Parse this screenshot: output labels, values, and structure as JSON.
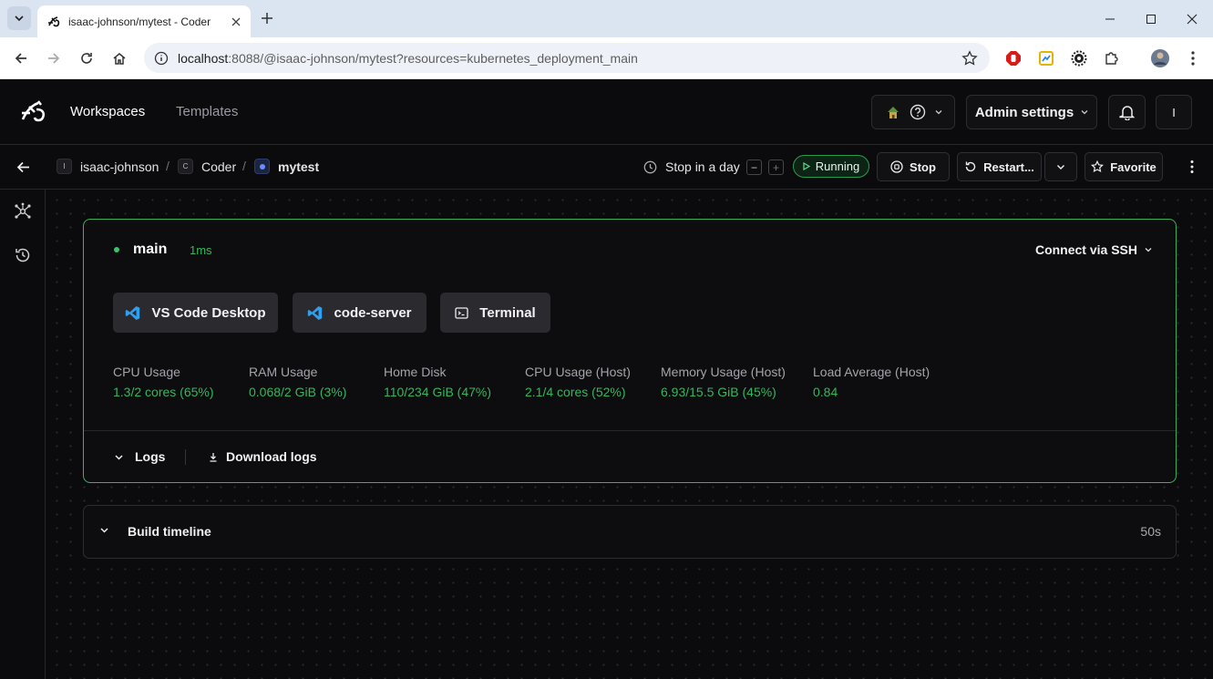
{
  "browser": {
    "tab_title": "isaac-johnson/mytest - Coder",
    "url_host": "localhost",
    "url_rest": ":8088/@isaac-johnson/mytest?resources=kubernetes_deployment_main"
  },
  "nav": {
    "workspaces": "Workspaces",
    "templates": "Templates",
    "admin_settings": "Admin settings",
    "user_initial": "I"
  },
  "workspace_bar": {
    "owner": "isaac-johnson",
    "owner_initial": "I",
    "template": "Coder",
    "template_initial": "C",
    "workspace": "mytest",
    "separator": "/",
    "schedule": "Stop in a day",
    "minus": "−",
    "plus": "+",
    "status": "Running",
    "stop": "Stop",
    "restart": "Restart...",
    "favorite": "Favorite"
  },
  "agent": {
    "name": "main",
    "latency": "1ms",
    "connect_ssh": "Connect via SSH",
    "apps": [
      {
        "label": "VS Code Desktop",
        "icon": "vscode-icon"
      },
      {
        "label": "code-server",
        "icon": "vscode-icon"
      },
      {
        "label": "Terminal",
        "icon": "terminal-icon"
      }
    ],
    "stats": [
      {
        "label": "CPU Usage",
        "value": "1.3/2 cores (65%)"
      },
      {
        "label": "RAM Usage",
        "value": "0.068/2 GiB (3%)"
      },
      {
        "label": "Home Disk",
        "value": "110/234 GiB (47%)"
      },
      {
        "label": "CPU Usage (Host)",
        "value": "2.1/4 cores (52%)"
      },
      {
        "label": "Memory Usage (Host)",
        "value": "6.93/15.5 GiB (45%)"
      },
      {
        "label": "Load Average (Host)",
        "value": "0.84"
      }
    ],
    "logs": "Logs",
    "download_logs": "Download logs"
  },
  "timeline": {
    "title": "Build timeline",
    "duration": "50s"
  },
  "colors": {
    "accent_green": "#35b55d",
    "agent_border": "#3fae5f",
    "background": "#0b0b0d"
  }
}
